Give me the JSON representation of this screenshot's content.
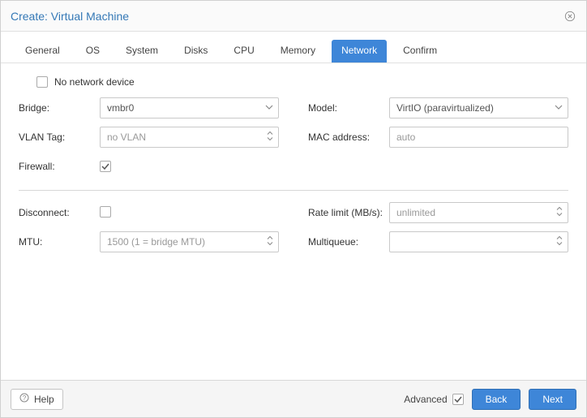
{
  "window": {
    "title": "Create: Virtual Machine"
  },
  "tabs": {
    "general": "General",
    "os": "OS",
    "system": "System",
    "disks": "Disks",
    "cpu": "CPU",
    "memory": "Memory",
    "network": "Network",
    "confirm": "Confirm",
    "active": "network"
  },
  "body": {
    "no_network_label": "No network device",
    "left": {
      "bridge_label": "Bridge:",
      "bridge_value": "vmbr0",
      "vlan_label": "VLAN Tag:",
      "vlan_value": "no VLAN",
      "firewall_label": "Firewall:",
      "firewall_checked": true
    },
    "right": {
      "model_label": "Model:",
      "model_value": "VirtIO (paravirtualized)",
      "mac_label": "MAC address:",
      "mac_value": "auto"
    },
    "adv_left": {
      "disconnect_label": "Disconnect:",
      "disconnect_checked": false,
      "mtu_label": "MTU:",
      "mtu_value": "1500 (1 = bridge MTU)"
    },
    "adv_right": {
      "rate_label": "Rate limit (MB/s):",
      "rate_value": "unlimited",
      "multiqueue_label": "Multiqueue:",
      "multiqueue_value": ""
    }
  },
  "footer": {
    "help_label": "Help",
    "advanced_label": "Advanced",
    "advanced_checked": true,
    "back_label": "Back",
    "next_label": "Next"
  }
}
